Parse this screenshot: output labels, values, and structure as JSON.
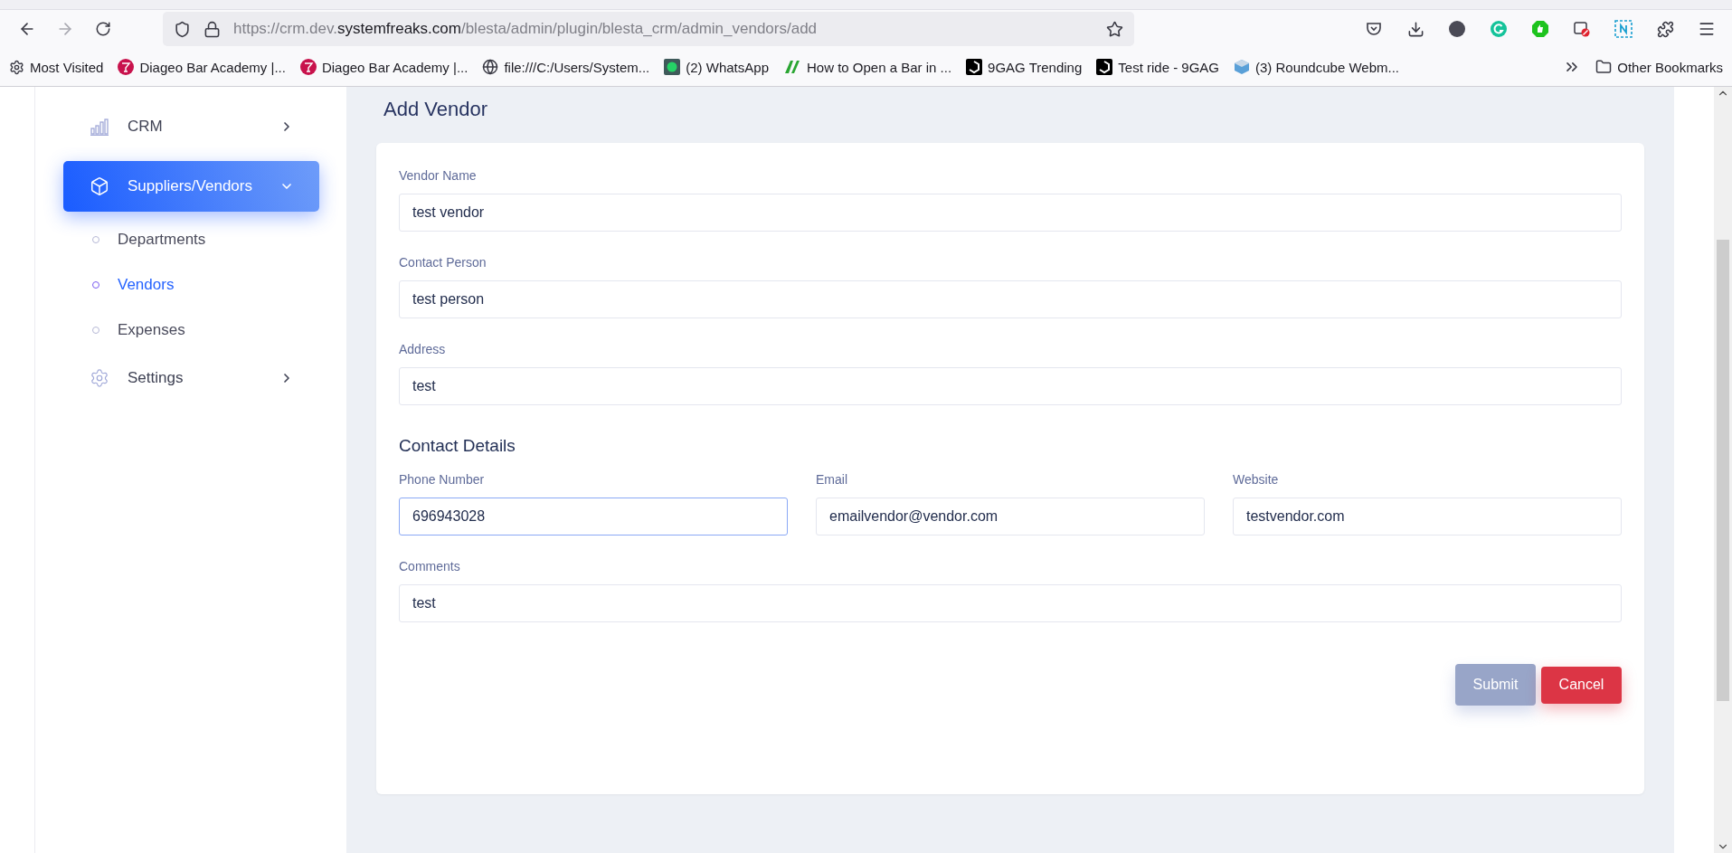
{
  "browser": {
    "url": {
      "prefix": "https://crm.dev.",
      "domain": "systemfreaks.com",
      "path": "/blesta/admin/plugin/blesta_crm/admin_vendors/add"
    },
    "bookmarks": [
      {
        "label": "Most Visited"
      },
      {
        "label": "Diageo Bar Academy |..."
      },
      {
        "label": "Diageo Bar Academy |..."
      },
      {
        "label": "file:///C:/Users/System..."
      },
      {
        "label": "(2) WhatsApp"
      },
      {
        "label": "How to Open a Bar in ..."
      },
      {
        "label": "9GAG Trending"
      },
      {
        "label": "Test ride - 9GAG"
      },
      {
        "label": "(3) Roundcube Webm..."
      }
    ],
    "other_bookmarks": "Other Bookmarks"
  },
  "sidebar": {
    "items": [
      {
        "label": "CRM",
        "selected": false,
        "expanded": false
      },
      {
        "label": "Suppliers/Vendors",
        "selected": true,
        "expanded": true,
        "children": [
          {
            "label": "Departments",
            "selected": false
          },
          {
            "label": "Vendors",
            "selected": true
          },
          {
            "label": "Expenses",
            "selected": false
          }
        ]
      },
      {
        "label": "Settings",
        "selected": false,
        "expanded": false
      }
    ]
  },
  "page_title": "Add Vendor",
  "form": {
    "fields": [
      {
        "label": "Vendor Name",
        "value": "test vendor",
        "focused": false
      },
      {
        "label": "Contact Person",
        "value": "test person",
        "focused": false
      },
      {
        "label": "Address",
        "value": "test",
        "focused": false
      }
    ],
    "section_title": "Contact Details",
    "contact_fields": [
      {
        "label": "Phone Number",
        "value": "696943028",
        "focused": true
      },
      {
        "label": "Email",
        "value": "emailvendor@vendor.com",
        "focused": false
      },
      {
        "label": "Website",
        "value": "testvendor.com",
        "focused": false
      }
    ],
    "comments": {
      "label": "Comments",
      "value": "test",
      "focused": false
    },
    "buttons": [
      {
        "label": "Submit",
        "kind": "submit",
        "disabled": true
      },
      {
        "label": "Cancel",
        "kind": "cancel",
        "disabled": false
      }
    ]
  }
}
